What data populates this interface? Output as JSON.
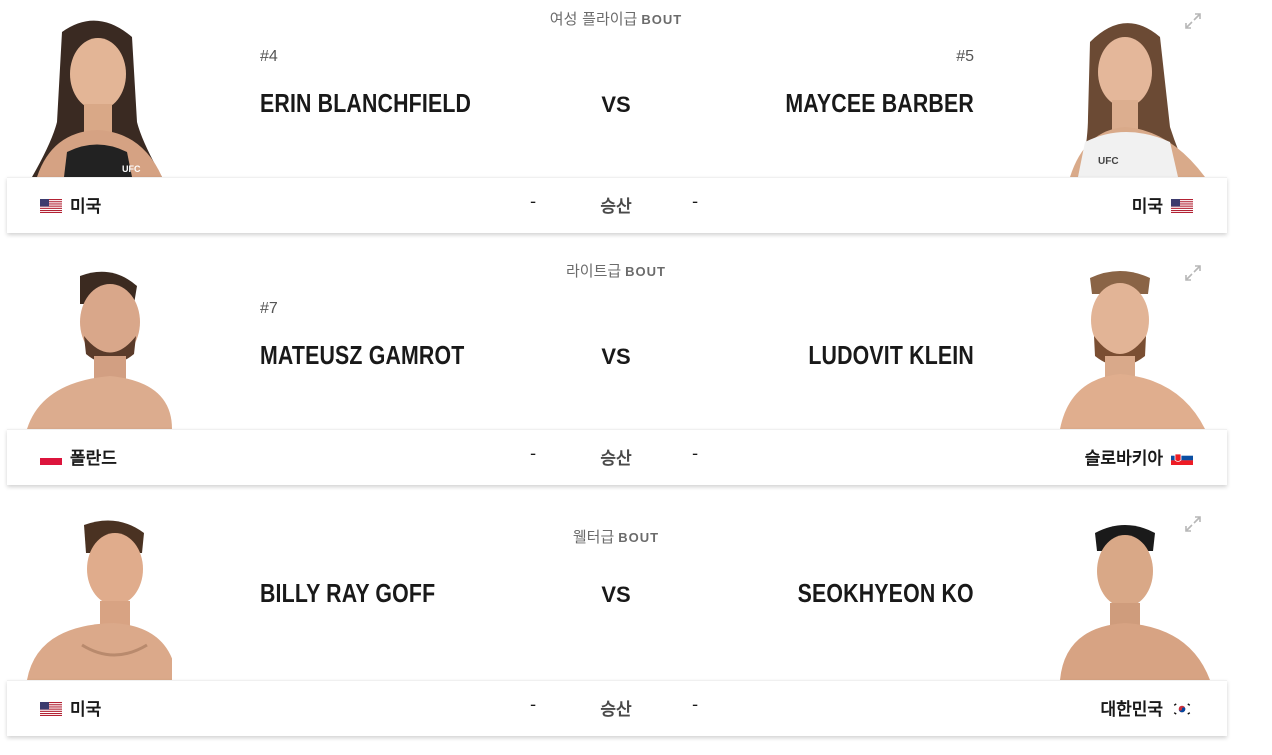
{
  "bouts": [
    {
      "division": "여성 플라이급",
      "bout_label": "BOUT",
      "left": {
        "rank": "#4",
        "name": "ERIN BLANCHFIELD",
        "country": "미국",
        "flag": "us"
      },
      "right": {
        "rank": "#5",
        "name": "MAYCEE BARBER",
        "country": "미국",
        "flag": "us"
      },
      "vs": "VS",
      "result": "승산",
      "left_odds": "-",
      "right_odds": "-"
    },
    {
      "division": "라이트급",
      "bout_label": "BOUT",
      "left": {
        "rank": "#7",
        "name": "MATEUSZ GAMROT",
        "country": "폴란드",
        "flag": "pl"
      },
      "right": {
        "rank": "",
        "name": "LUDOVIT KLEIN",
        "country": "슬로바키아",
        "flag": "sk"
      },
      "vs": "VS",
      "result": "승산",
      "left_odds": "-",
      "right_odds": "-"
    },
    {
      "division": "웰터급",
      "bout_label": "BOUT",
      "left": {
        "rank": "",
        "name": "BILLY RAY GOFF",
        "country": "미국",
        "flag": "us"
      },
      "right": {
        "rank": "",
        "name": "SEOKHYEON KO",
        "country": "대한민국",
        "flag": "kr"
      },
      "vs": "VS",
      "result": "승산",
      "left_odds": "-",
      "right_odds": "-"
    }
  ],
  "icons": {
    "expand": "expand-icon",
    "fighter_photo": "fighter-photo"
  },
  "colors": {
    "text": "#191919",
    "muted": "#6b6b6b",
    "expand_icon": "#b7b7b7"
  }
}
